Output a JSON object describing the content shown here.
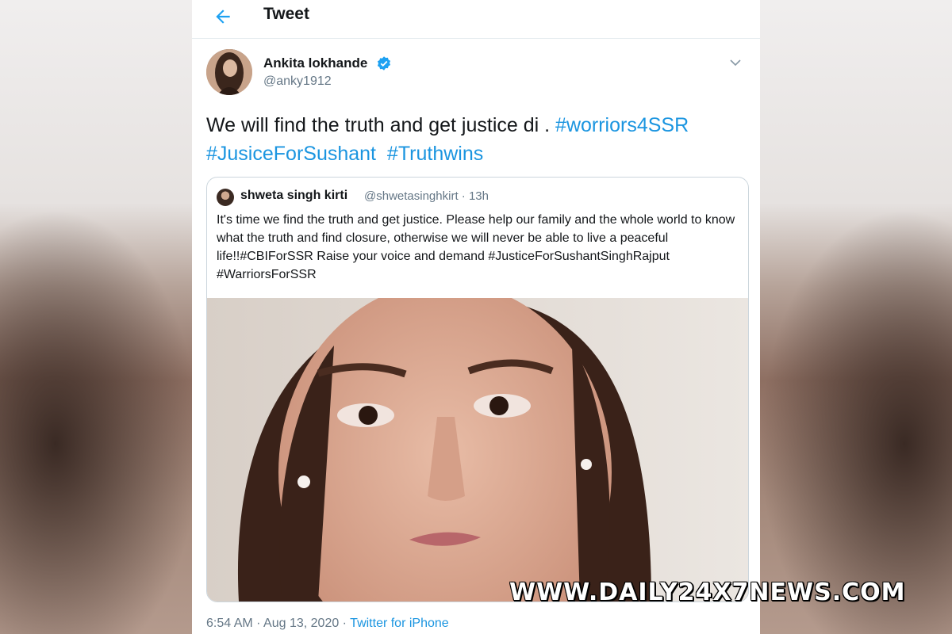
{
  "header": {
    "title": "Tweet",
    "back_icon": "arrow-left-icon"
  },
  "tweet": {
    "author_name": "Ankita lokhande",
    "author_handle": "@anky1912",
    "verified": true,
    "text_plain": "We will find the truth and get justice di . ",
    "hashtags": [
      "#worriors4SSR",
      "#JusiceForSushant",
      "#Truthwins"
    ],
    "timestamp": "6:54 AM · Aug 13, 2020 · ",
    "source": "Twitter for iPhone"
  },
  "quoted": {
    "author_name": "shweta singh kirti",
    "author_handle": "@shwetasinghkirt",
    "age": "· 13h",
    "text": "It's time we find the truth and get justice. Please help our family and the whole world to know what the truth and find closure, otherwise we will never be able to live a peaceful life!!#CBIForSSR Raise your voice and demand #JusticeForSushantSinghRajput #WarriorsForSSR"
  },
  "watermark": "WWW.DAILY24X7NEWS.COM",
  "colors": {
    "link": "#1b95e0",
    "verified": "#1da1f2",
    "text": "#14171a",
    "muted": "#657786"
  }
}
